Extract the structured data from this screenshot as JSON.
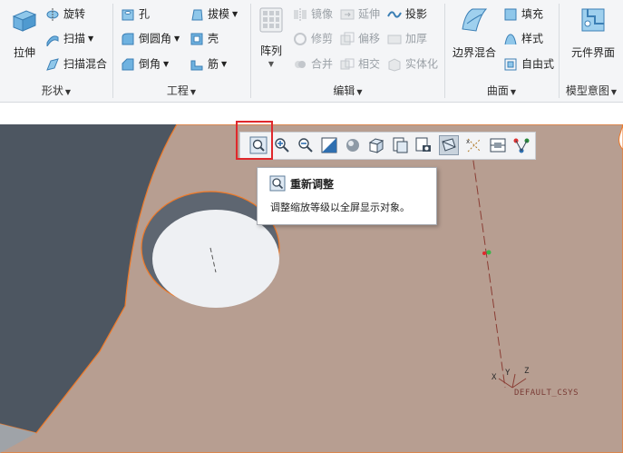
{
  "ribbon": {
    "shape": {
      "label": "形状",
      "extrude": "拉伸",
      "revolve": "旋转",
      "sweep": "扫描",
      "swept_blend": "扫描混合"
    },
    "engineering": {
      "label": "工程",
      "hole": "孔",
      "round": "倒圆角",
      "chamfer": "倒角",
      "draft": "拔模",
      "shell": "壳",
      "rib": "筋"
    },
    "editing": {
      "label": "编辑",
      "pattern": "阵列",
      "mirror": "镜像",
      "trim": "修剪",
      "merge": "合并",
      "extend": "延伸",
      "offset": "偏移",
      "intersect": "相交",
      "project": "投影",
      "thicken": "加厚",
      "solidify": "实体化"
    },
    "surfaces": {
      "label": "曲面",
      "boundary_blend": "边界混合",
      "fill": "填充",
      "style": "样式",
      "freestyle": "自由式"
    },
    "model_intent": {
      "label": "模型意图",
      "component_interface": "元件界面"
    }
  },
  "view_toolbar": {
    "icons": [
      "refit-icon",
      "zoom-in-icon",
      "zoom-out-icon",
      "repaint-icon",
      "display-style-icon",
      "saved-orientations-icon",
      "named-views-icon",
      "view-manager-icon",
      "perspective-view-icon",
      "datum-display-icon",
      "spin-center-icon",
      "annotation-display-icon"
    ]
  },
  "tooltip": {
    "title": "重新调整",
    "description": "调整缩放等级以全屏显示对象。"
  },
  "model": {
    "csys_label": "DEFAULT_CSYS",
    "axis_x": "X",
    "axis_y": "Y",
    "axis_z": "Z"
  },
  "colors": {
    "part_fill": "#b79e91",
    "background": "#5d6570",
    "edge": "#f07a28",
    "highlight": "#e0282c"
  }
}
